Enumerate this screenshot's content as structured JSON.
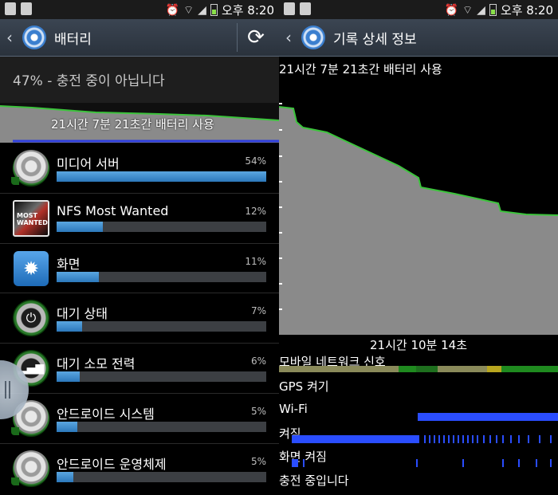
{
  "status_bar": {
    "time": "오후 8:20"
  },
  "left": {
    "title": "배터리",
    "status_text": "47% - 충전 중이 아닙니다",
    "usage_label": "21시간 7분 21초간 배터리 사용",
    "items": [
      {
        "name": "미디어 서버",
        "percent": "54%",
        "fraction": 1.0,
        "icon": "media-server-icon"
      },
      {
        "name": "NFS Most Wanted",
        "percent": "12%",
        "fraction": 0.22,
        "icon": "nfs-game-icon"
      },
      {
        "name": "화면",
        "percent": "11%",
        "fraction": 0.2,
        "icon": "screen-brightness-icon"
      },
      {
        "name": "대기 상태",
        "percent": "7%",
        "fraction": 0.12,
        "icon": "power-icon"
      },
      {
        "name": "대기 소모 전력",
        "percent": "6%",
        "fraction": 0.11,
        "icon": "signal-strength-icon"
      },
      {
        "name": "안드로이드 시스템",
        "percent": "5%",
        "fraction": 0.1,
        "icon": "android-system-icon"
      },
      {
        "name": "안드로이드 운영체제",
        "percent": "5%",
        "fraction": 0.08,
        "icon": "android-os-icon"
      }
    ]
  },
  "right": {
    "title": "기록 상세 정보",
    "usage_label": "21시간 7분 21초간 배터리 사용",
    "duration_label": "21시간 10분 14초",
    "signals": {
      "mobile": "모바일 네트워크 신호",
      "gps": "GPS 켜기",
      "wifi": "Wi-Fi",
      "awake": "켜짐",
      "screen": "화면 켜짐",
      "charging": "충전 중입니다"
    }
  },
  "colors": {
    "bar_fill": "#3a8bd0",
    "battery_line": "#3cc43c",
    "battery_fill": "#8a8a8a",
    "wifi_blue": "#2a4dff"
  }
}
